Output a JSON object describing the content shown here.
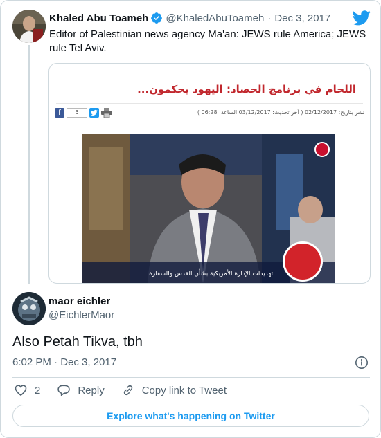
{
  "parent_tweet": {
    "name": "Khaled Abu Toameh",
    "handle": "@KhaledAbuToameh",
    "separator": "·",
    "date": "Dec 3, 2017",
    "text": "Editor of Palestinian news agency Ma'an: JEWS rule America; JEWS rule Tel Aviv.",
    "media": {
      "article_title": "اللحام في برنامج الحصاد: اليهود يحكمون...",
      "share_count": "6",
      "meta_line": "نشر بتاريخ: 02/12/2017 ( آخر تحديث: 03/12/2017 الساعة: 06:28 )",
      "video_caption": "تهديدات الإدارة الأمريكية بشأن القدس والسفارة"
    }
  },
  "reply_tweet": {
    "name": "maor eichler",
    "handle": "@EichlerMaor",
    "text": "Also Petah Tikva, tbh",
    "timestamp": "6:02 PM · Dec 3, 2017"
  },
  "actions": {
    "like_count": "2",
    "reply_label": "Reply",
    "copy_link_label": "Copy link to Tweet"
  },
  "explore_label": "Explore what's happening on Twitter",
  "colors": {
    "twitter_blue": "#1d9bf0",
    "text_primary": "#0f1419",
    "text_secondary": "#536471",
    "border": "#cfd9de",
    "headline_red": "#c1272d"
  },
  "icons": {
    "verified": "verified-badge-icon",
    "brand": "twitter-bird-icon",
    "info": "info-icon",
    "like": "heart-icon",
    "reply": "speech-bubble-icon",
    "copy_link": "link-icon"
  }
}
